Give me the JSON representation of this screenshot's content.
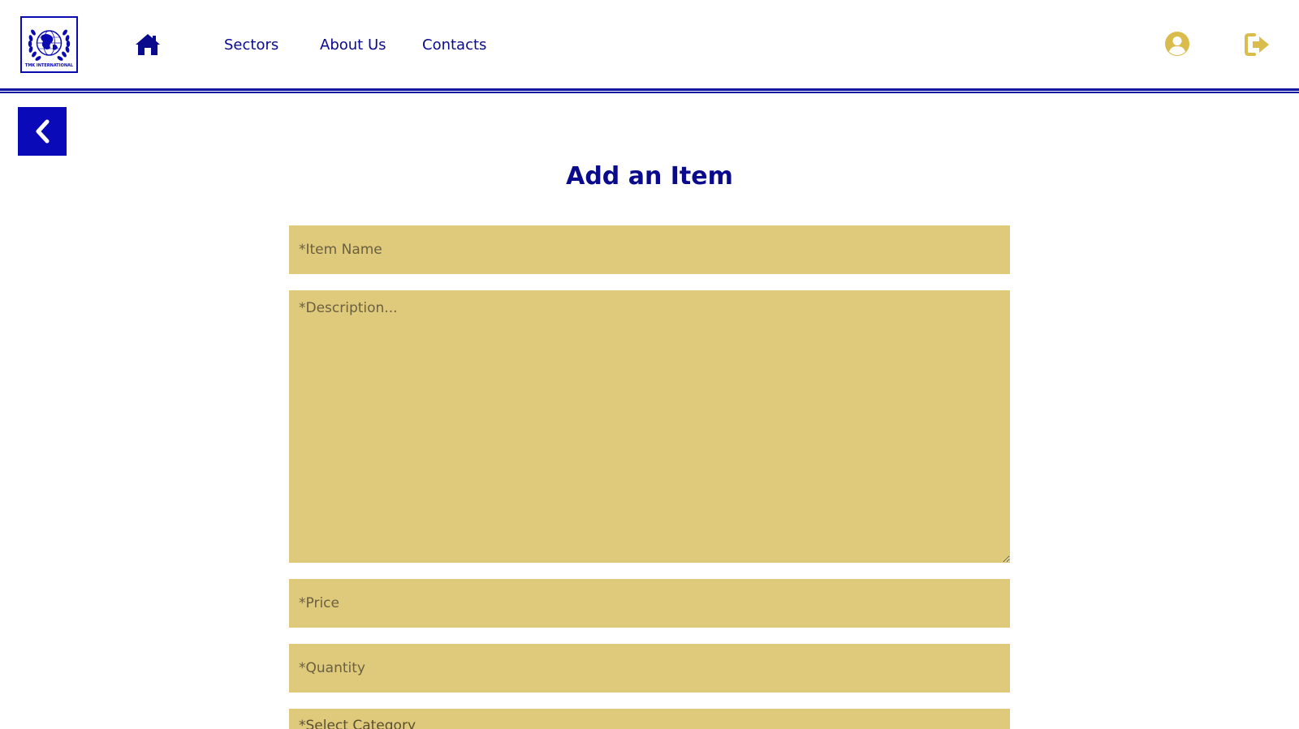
{
  "brand": {
    "logo_text": "TMK INTERNATIONAL"
  },
  "nav": {
    "home_icon": "home-icon",
    "links": [
      {
        "label": "Sectors"
      },
      {
        "label": "About Us"
      },
      {
        "label": "Contacts"
      }
    ],
    "profile_icon": "user-circle-icon",
    "logout_icon": "sign-out-icon"
  },
  "back": {
    "icon": "chevron-left-icon"
  },
  "form": {
    "title": "Add an Item",
    "item_name": {
      "placeholder": "*Item Name",
      "value": ""
    },
    "description": {
      "placeholder": "*Description...",
      "value": ""
    },
    "price": {
      "placeholder": "*Price",
      "value": ""
    },
    "quantity": {
      "placeholder": "*Quantity",
      "value": ""
    },
    "category": {
      "selected": "*Select Category"
    }
  },
  "colors": {
    "primary": "#0a0ab8",
    "nav_text": "#0a0a8c",
    "accent_gold": "#d9bc4c",
    "field_bg": "#dfc97a"
  }
}
